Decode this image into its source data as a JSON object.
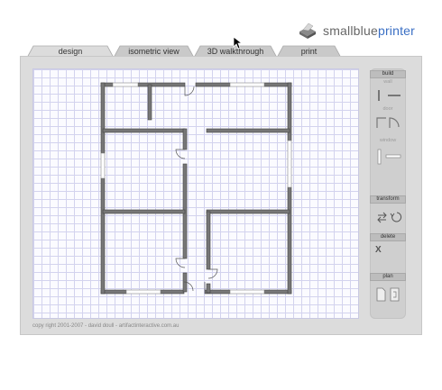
{
  "brand": {
    "name_part1": "smallblue",
    "name_part2": "printer",
    "accent": "#3a6fc4"
  },
  "tabs": [
    {
      "label": "design",
      "active": true
    },
    {
      "label": "isometric view",
      "active": false
    },
    {
      "label": "3D walkthrough",
      "active": false
    },
    {
      "label": "print",
      "active": false
    }
  ],
  "panel": {
    "build": "build",
    "wall": "wall",
    "door": "door",
    "window": "window",
    "transform": "transform",
    "delete": "delete",
    "delete_icon": "X",
    "plan": "plan"
  },
  "footer": {
    "copyright": "copy right 2001-2007 - david doull - artifactinteractive.com.au"
  },
  "colors": {
    "wall": "#777777",
    "grid": "#d3d3ee",
    "panel": "#cfcfcf"
  }
}
